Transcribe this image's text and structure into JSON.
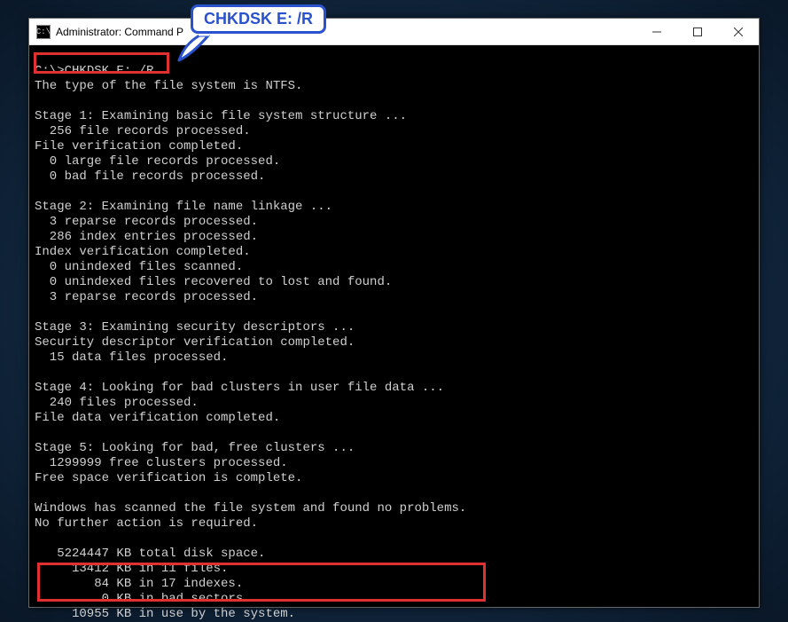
{
  "window": {
    "title": "Administrator: Command P",
    "icon_glyph": "C:\\"
  },
  "callout": {
    "text": "CHKDSK E: /R"
  },
  "terminal": {
    "prompt": "C:\\>",
    "command": "CHKDSK E: /R",
    "fs_type_line": "The type of the file system is NTFS.",
    "stage1": {
      "header": "Stage 1: Examining basic file system structure ...",
      "records": "  256 file records processed.",
      "file_verif": "File verification completed.",
      "large_files": "  0 large file records processed.",
      "bad_files": "  0 bad file records processed."
    },
    "stage2": {
      "header": "Stage 2: Examining file name linkage ...",
      "reparse": "  3 reparse records processed.",
      "index": "  286 index entries processed.",
      "index_verif": "Index verification completed.",
      "unindexed": "  0 unindexed files scanned.",
      "recovered": "  0 unindexed files recovered to lost and found.",
      "reparse2": "  3 reparse records processed."
    },
    "stage3": {
      "header": "Stage 3: Examining security descriptors ...",
      "sec_verif": "Security descriptor verification completed.",
      "data_files": "  15 data files processed."
    },
    "stage4": {
      "header": "Stage 4: Looking for bad clusters in user file data ...",
      "files": "  240 files processed.",
      "file_data": "File data verification completed."
    },
    "stage5": {
      "header": "Stage 5: Looking for bad, free clusters ...",
      "free_clusters": "  1299999 free clusters processed.",
      "free_space": "Free space verification is complete."
    },
    "result": {
      "line1": "Windows has scanned the file system and found no problems.",
      "line2": "No further action is required."
    },
    "summary": {
      "total": "   5224447 KB total disk space.",
      "files": "     13412 KB in 11 files.",
      "indexes": "        84 KB in 17 indexes.",
      "bad": "         0 KB in bad sectors.",
      "system": "     10955 KB in use by the system."
    }
  }
}
